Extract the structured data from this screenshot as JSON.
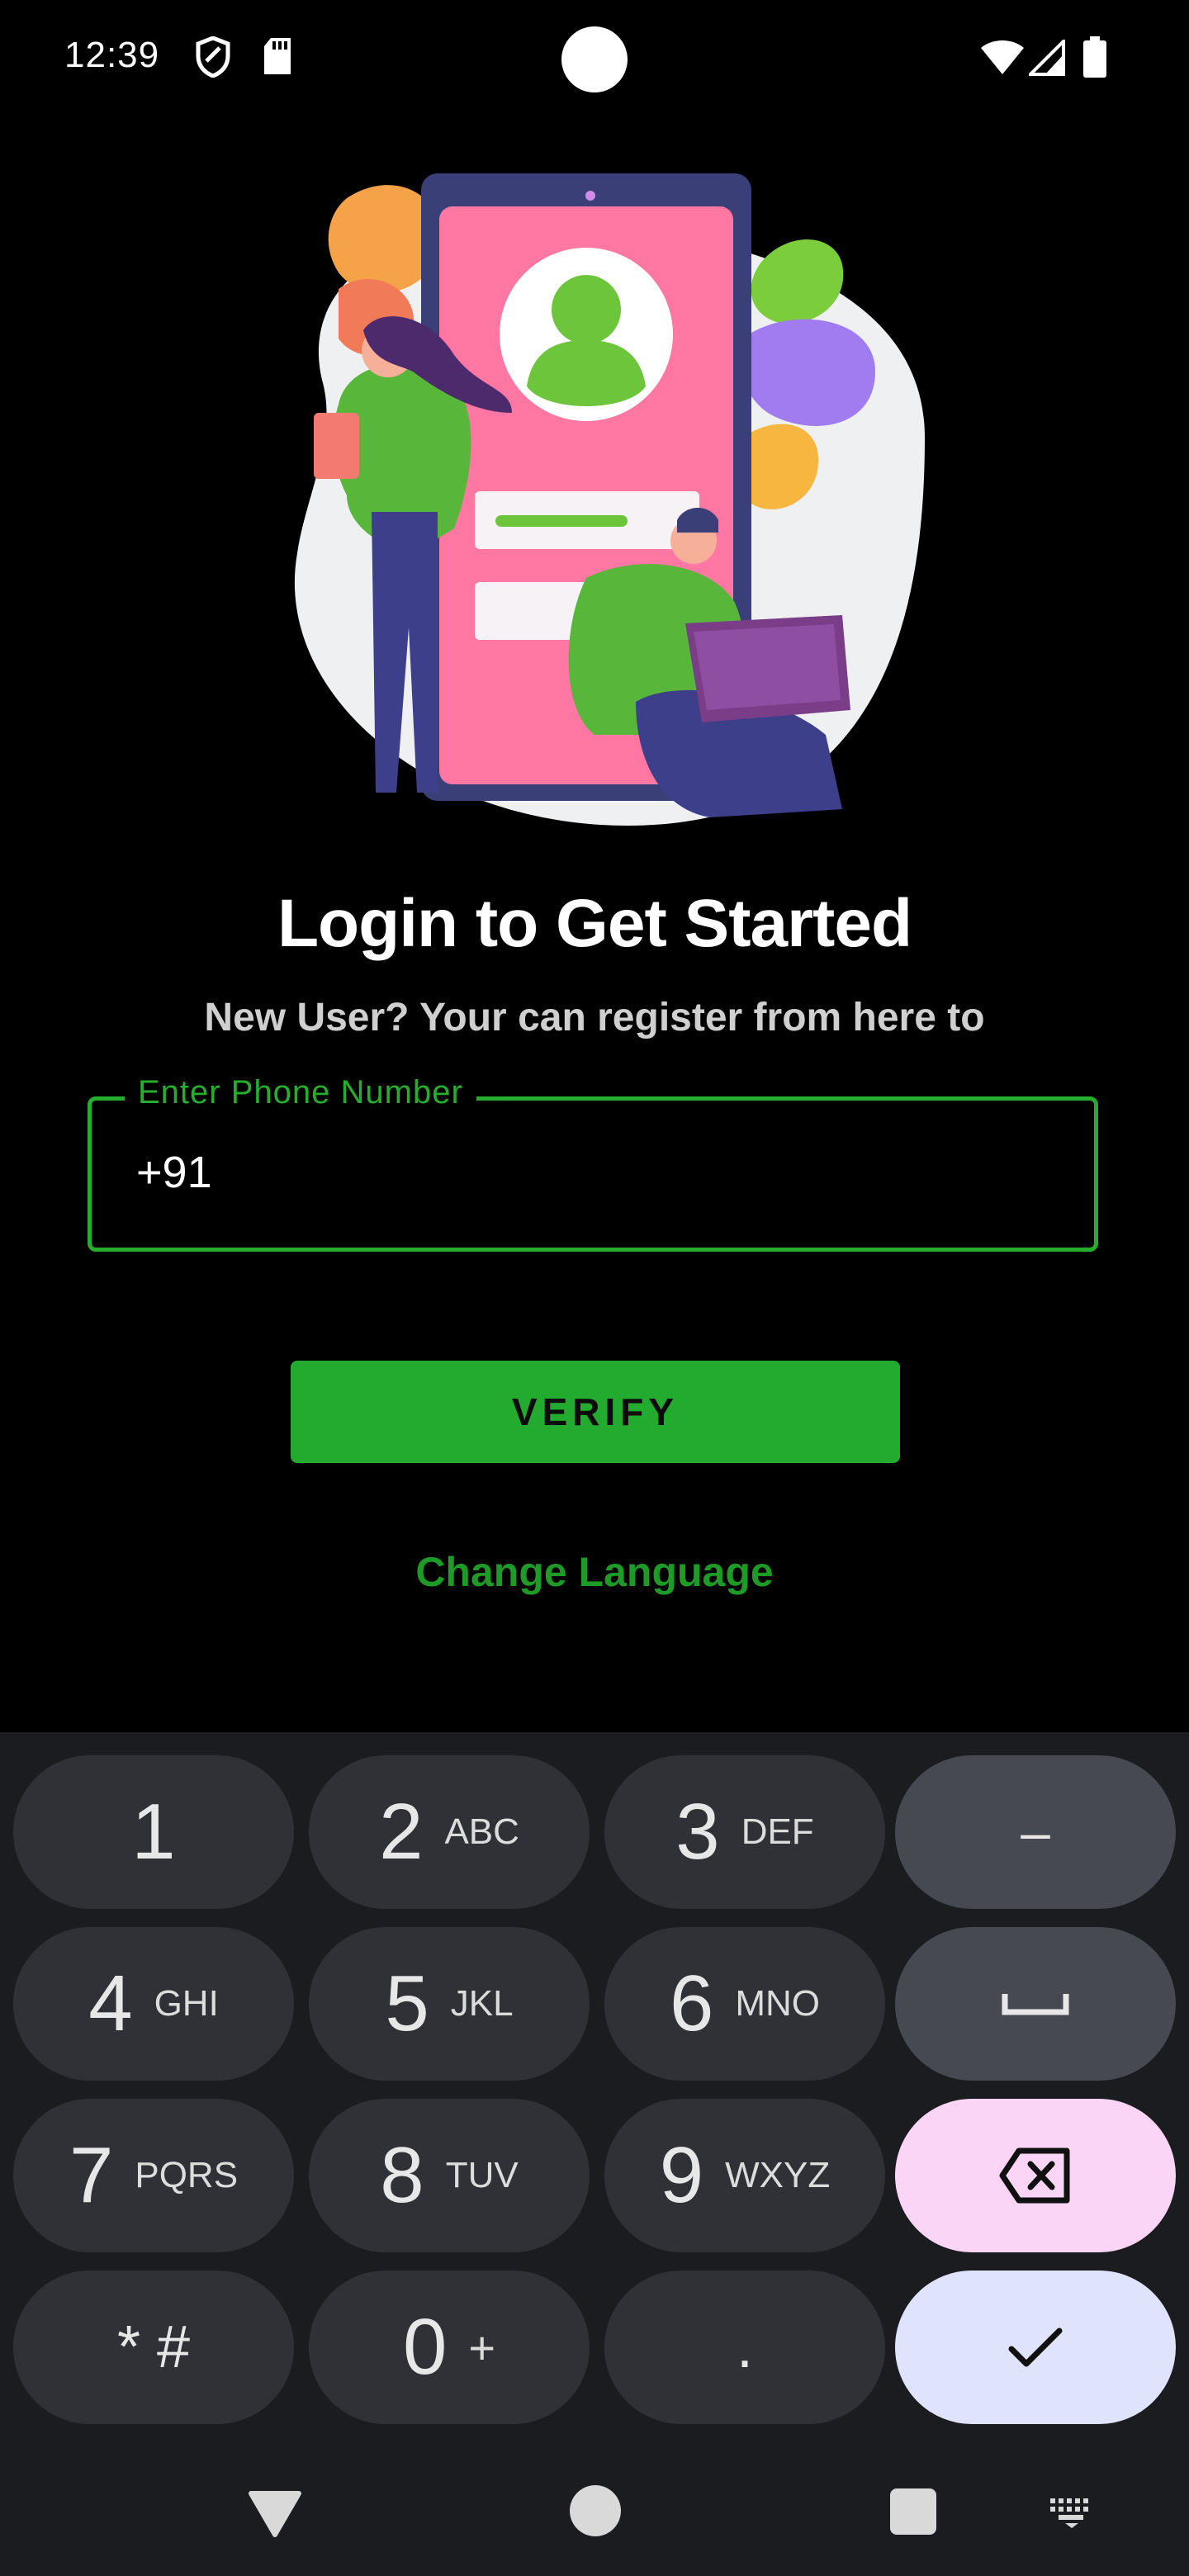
{
  "status_bar": {
    "time": "12:39",
    "icons": [
      "shield-icon",
      "sd-card-icon",
      "wifi-icon",
      "signal-icon",
      "battery-icon"
    ]
  },
  "login": {
    "title": "Login to Get Started",
    "subtitle": "New User? Your can register from here to",
    "phone_field": {
      "label": "Enter Phone Number",
      "value": "+91"
    },
    "verify_label": "VERIFY",
    "change_language_label": "Change Language"
  },
  "keyboard": {
    "keys": [
      {
        "num": "1",
        "sub": ""
      },
      {
        "num": "2",
        "sub": "ABC"
      },
      {
        "num": "3",
        "sub": "DEF"
      },
      {
        "num": "–",
        "sub": ""
      },
      {
        "num": "4",
        "sub": "GHI"
      },
      {
        "num": "5",
        "sub": "JKL"
      },
      {
        "num": "6",
        "sub": "MNO"
      },
      {
        "num": "7",
        "sub": "PQRS"
      },
      {
        "num": "8",
        "sub": "TUV"
      },
      {
        "num": "9",
        "sub": "WXYZ"
      },
      {
        "num": "* #",
        "sub": ""
      },
      {
        "num": "0",
        "sub": "+"
      },
      {
        "num": ".",
        "sub": ""
      }
    ]
  },
  "colors": {
    "accent_green": "#25ae2e",
    "background": "#000000",
    "keyboard_bg": "#1b1c20"
  }
}
